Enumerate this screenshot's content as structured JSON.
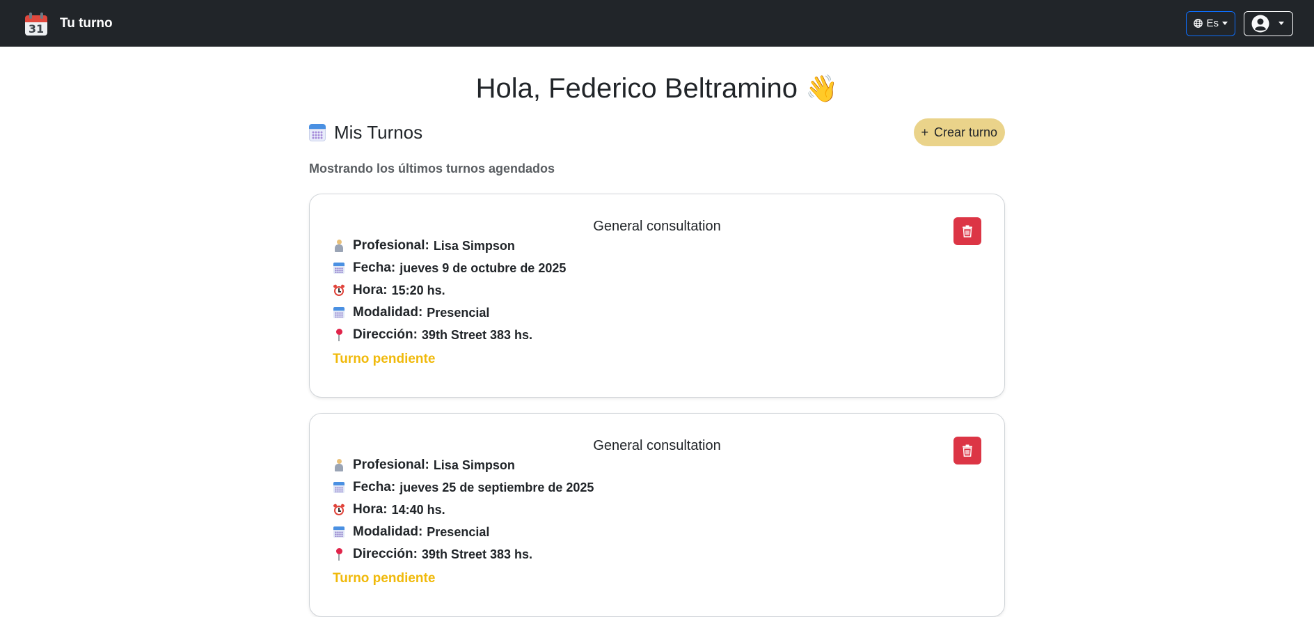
{
  "navbar": {
    "logo_day": "31",
    "brand": "Tu turno",
    "language": "Es",
    "globe_icon": "globe-icon",
    "user_icon": "user-circle-icon"
  },
  "greeting": {
    "text": "Hola, Federico Beltramino",
    "emoji": "👋"
  },
  "section": {
    "title": "Mis Turnos",
    "create_button": "Crear turno",
    "create_icon": "+",
    "subtitle": "Mostrando los últimos turnos agendados"
  },
  "labels": {
    "professional": "Profesional:",
    "date": "Fecha:",
    "time": "Hora:",
    "modality": "Modalidad:",
    "address": "Dirección:"
  },
  "appointments": [
    {
      "title": "General consultation",
      "professional": "Lisa Simpson",
      "date": "jueves 9 de octubre de 2025",
      "time": "15:20 hs.",
      "modality": "Presencial",
      "address": "39th Street 383 hs.",
      "status": "Turno pendiente"
    },
    {
      "title": "General consultation",
      "professional": "Lisa Simpson",
      "date": "jueves 25 de septiembre de 2025",
      "time": "14:40 hs.",
      "modality": "Presencial",
      "address": "39th Street 383 hs.",
      "status": "Turno pendiente"
    }
  ],
  "colors": {
    "navbar_bg": "#212529",
    "create_button_bg": "#ead38a",
    "delete_button_bg": "#dc3545",
    "status_pending": "#f0b90a",
    "language_border": "#0d6efd"
  }
}
